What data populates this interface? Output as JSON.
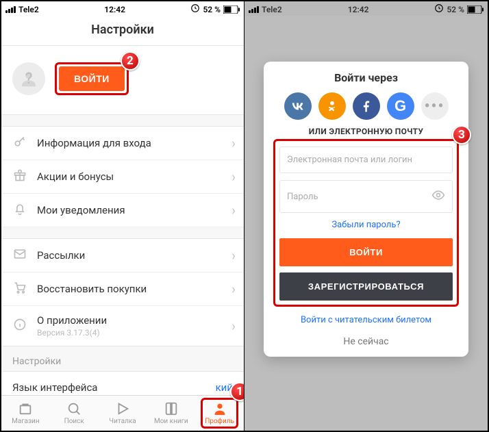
{
  "status": {
    "carrier": "Tele2",
    "time": "12:42",
    "battery_pct": "52 %"
  },
  "left": {
    "header_title": "Настройки",
    "login_button": "ВОЙТИ",
    "items": {
      "login_info": "Информация для входа",
      "promos": "Акции и бонусы",
      "notifications": "Мои уведомления",
      "newsletters": "Рассылки",
      "restore": "Восстановить покупки",
      "about": "О приложении",
      "about_version": "Версия 3.17.3(4)"
    },
    "settings_label": "Настройки",
    "language_label": "Язык интерфейса",
    "language_value_fragment": "кий",
    "tabs": {
      "store": "Магазин",
      "search": "Поиск",
      "reader": "Читалка",
      "mybooks": "Мои книги",
      "profile": "Профиль"
    }
  },
  "right": {
    "modal_title": "Войти через",
    "or_email": "ИЛИ ЭЛЕКТРОННУЮ ПОЧТУ",
    "email_placeholder": "Электронная почта или логин",
    "password_placeholder": "Пароль",
    "forgot": "Забыли пароль?",
    "login_btn": "ВОЙТИ",
    "register_btn": "ЗАРЕГИСТРИРОВАТЬСЯ",
    "reader_card": "Войти с читательским билетом",
    "not_now": "Не сейчас"
  },
  "badges": {
    "one": "1",
    "two": "2",
    "three": "3"
  }
}
